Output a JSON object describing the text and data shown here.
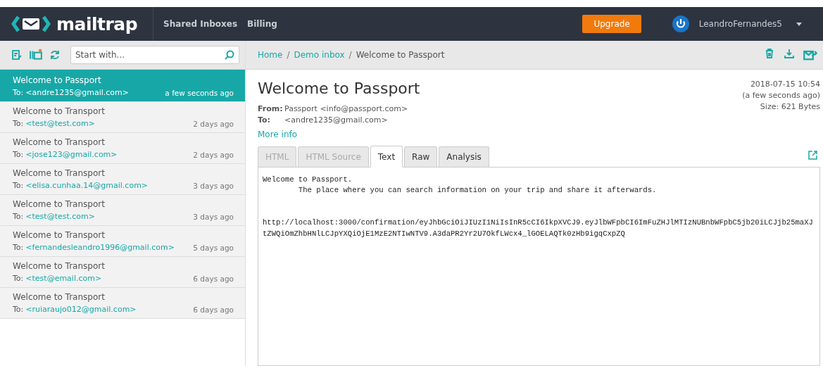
{
  "navbar": {
    "logo": "mailtrap",
    "links": [
      "Shared Inboxes",
      "Billing"
    ],
    "upgrade": "Upgrade",
    "user": "LeandroFernandes5"
  },
  "toolbar": {
    "search": {
      "placeholder": "Start with..."
    }
  },
  "breadcrumb": {
    "separator": "/",
    "items": [
      "Home",
      "Demo inbox",
      "Welcome to Passport"
    ]
  },
  "messages": [
    {
      "subject": "Welcome to Passport",
      "to_label": "To:",
      "to": "<andre1235@gmail.com>",
      "time": "a few seconds ago",
      "selected": true
    },
    {
      "subject": "Welcome to Transport",
      "to_label": "To:",
      "to": "<test@test.com>",
      "time": "2 days ago",
      "selected": false
    },
    {
      "subject": "Welcome to Transport",
      "to_label": "To:",
      "to": "<jose123@gmail.com>",
      "time": "2 days ago",
      "selected": false
    },
    {
      "subject": "Welcome to Transport",
      "to_label": "To:",
      "to": "<elisa.cunhaa.14@gmail.com>",
      "time": "3 days ago",
      "selected": false
    },
    {
      "subject": "Welcome to Transport",
      "to_label": "To:",
      "to": "<test@test.com>",
      "time": "3 days ago",
      "selected": false
    },
    {
      "subject": "Welcome to Transport",
      "to_label": "To:",
      "to": "<fernandesleandro1996@gmail.com>",
      "time": "5 days ago",
      "selected": false
    },
    {
      "subject": "Welcome to Transport",
      "to_label": "To:",
      "to": "<test@email.com>",
      "time": "6 days ago",
      "selected": false
    },
    {
      "subject": "Welcome to Transport",
      "to_label": "To:",
      "to": "<ruiaraujo012@gmail.com>",
      "time": "6 days ago",
      "selected": false
    }
  ],
  "message": {
    "title": "Welcome to Passport",
    "date": "2018-07-15 10:54",
    "relative": "(a few seconds ago)",
    "size": "Size: 621 Bytes",
    "from_label": "From:",
    "from": "Passport <info@passport.com>",
    "to_label": "To:",
    "to": "<andre1235@gmail.com>",
    "more_info": "More info",
    "tabs": [
      {
        "label": "HTML",
        "selected": false,
        "disabled": true
      },
      {
        "label": "HTML Source",
        "selected": false,
        "disabled": true
      },
      {
        "label": "Text",
        "selected": true,
        "disabled": false
      },
      {
        "label": "Raw",
        "selected": false,
        "disabled": false
      },
      {
        "label": "Analysis",
        "selected": false,
        "disabled": false
      }
    ],
    "body": "Welcome to Passport.\n        The place where you can search information on your trip and share it afterwards.\n\n\nhttp://localhost:3000/confirmation/eyJhbGciOiJIUzI1NiIsInR5cCI6IkpXVCJ9.eyJlbWFpbCI6ImFuZHJlMTIzNUBnbWFpbC5jb20iLCJjb25maXJtZWQiOmZhbHNlLCJpYXQiOjE1MzE2NTIwNTV9.A3daPR2Yr2U7OkfLWcx4_lGOELAQTk0zHb9igqCxpZQ"
  }
}
